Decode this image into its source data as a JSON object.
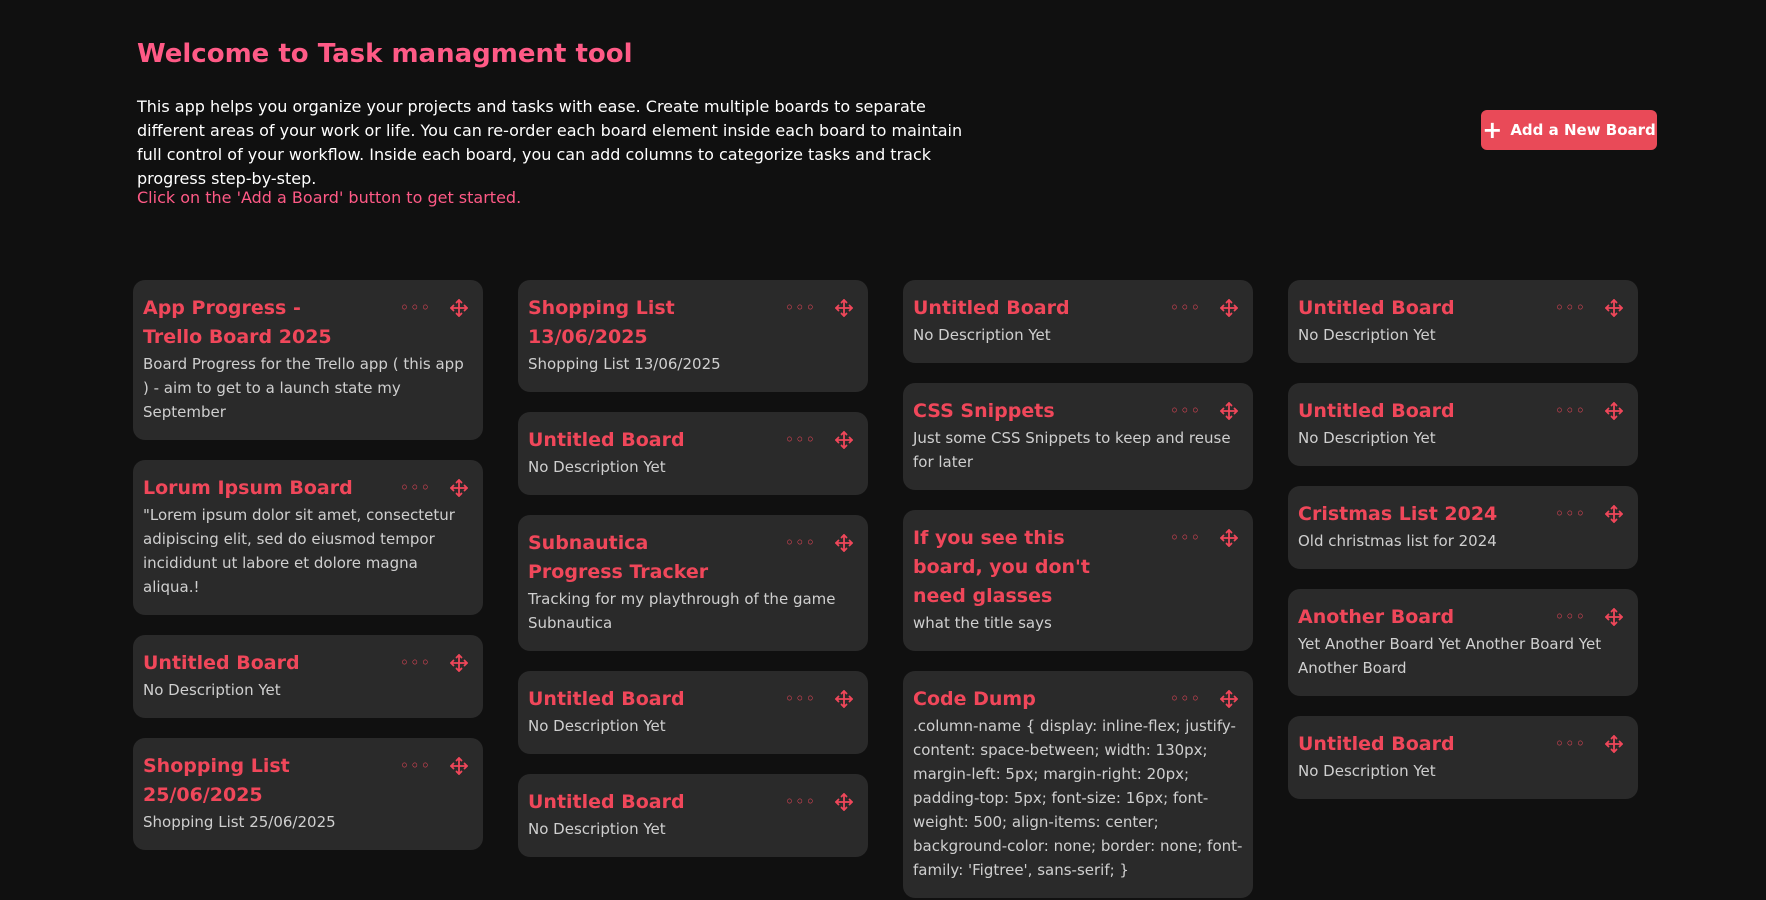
{
  "header": {
    "title": "Welcome to Task managment tool",
    "intro": "This app helps you organize your projects and tasks with ease. Create multiple boards to separate different areas of your work or life. You can re-order each board element inside each board to maintain full control of your workflow. Inside each board, you can add columns to categorize tasks and track progress step-by-step.",
    "hint": "Click on the 'Add a Board' button to get started.",
    "add_button_label": "Add a New Board"
  },
  "icons": {
    "more": "more-horizontal-icon",
    "move": "move-arrows-icon",
    "add": "plus-icon"
  },
  "colors": {
    "background": "#101010",
    "card": "#2a2a2a",
    "accent": "#f0475a",
    "title_pink": "#ff5a86",
    "button": "#e94a58"
  },
  "columns": [
    {
      "boards": [
        {
          "title": "App Progress - Trello Board 2025",
          "description": "Board Progress for the Trello app ( this app ) - aim to get to a launch state my September"
        },
        {
          "title": "Lorum Ipsum Board",
          "description": "\"Lorem ipsum dolor sit amet, consectetur adipiscing elit, sed do eiusmod tempor incididunt ut labore et dolore magna aliqua.!"
        },
        {
          "title": "Untitled Board",
          "description": "No Description Yet"
        },
        {
          "title": "Shopping List 25/06/2025",
          "description": "Shopping List 25/06/2025"
        }
      ]
    },
    {
      "boards": [
        {
          "title": "Shopping List 13/06/2025",
          "description": "Shopping List 13/06/2025"
        },
        {
          "title": "Untitled Board",
          "description": "No Description Yet"
        },
        {
          "title": "Subnautica Progress Tracker",
          "description": "Tracking for my playthrough of the game Subnautica"
        },
        {
          "title": "Untitled Board",
          "description": "No Description Yet"
        },
        {
          "title": "Untitled Board",
          "description": "No Description Yet"
        }
      ]
    },
    {
      "boards": [
        {
          "title": "Untitled Board",
          "description": "No Description Yet"
        },
        {
          "title": "CSS Snippets",
          "description": "Just some CSS Snippets to keep and reuse for later"
        },
        {
          "title": "If you see this board, you don't need glasses",
          "description": "what the title says"
        },
        {
          "title": "Code Dump",
          "description": ".column-name { display: inline-flex; justify-content: space-between; width: 130px; margin-left: 5px; margin-right: 20px; padding-top: 5px; font-size: 16px; font-weight: 500; align-items: center; background-color: none; border: none; font-family: 'Figtree', sans-serif; }"
        }
      ]
    },
    {
      "boards": [
        {
          "title": "Untitled Board",
          "description": "No Description Yet"
        },
        {
          "title": "Untitled Board",
          "description": "No Description Yet"
        },
        {
          "title": "Cristmas List 2024",
          "description": "Old christmas list for 2024"
        },
        {
          "title": "Another Board",
          "description": "Yet Another Board Yet Another Board Yet Another Board"
        },
        {
          "title": "Untitled Board",
          "description": "No Description Yet"
        }
      ]
    }
  ]
}
